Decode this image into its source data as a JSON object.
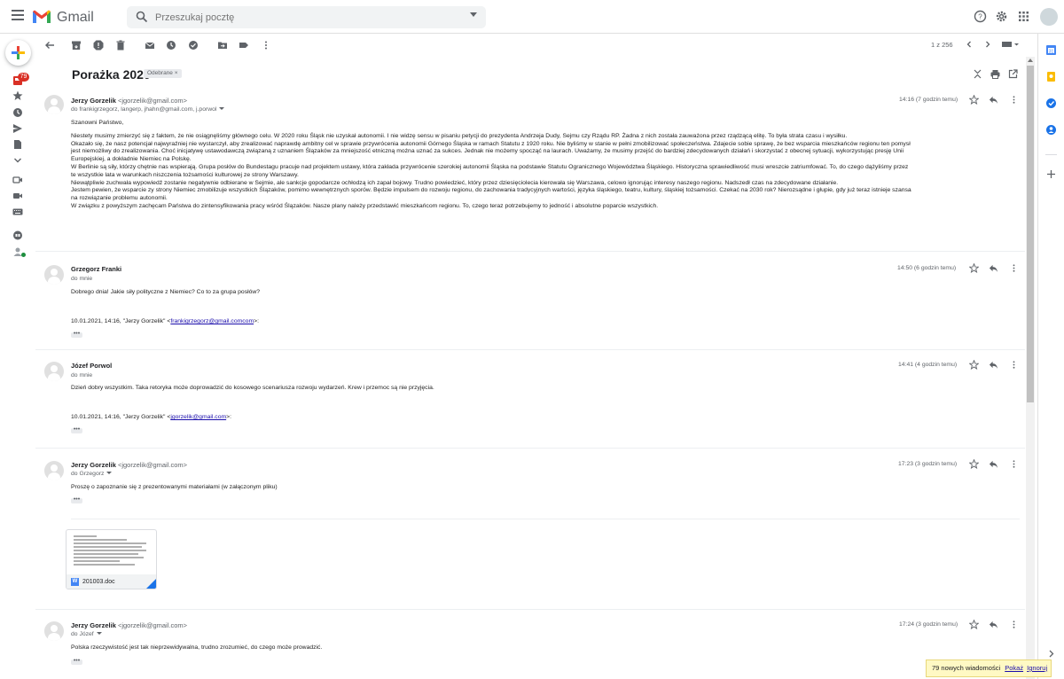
{
  "app": {
    "name": "Gmail"
  },
  "search": {
    "placeholder": "Przeszukaj pocztę"
  },
  "rail": {
    "inbox_badge": "79"
  },
  "pager": {
    "text": "1 z 256"
  },
  "thread": {
    "subject": "Porażka 2020",
    "label": "Odebrane ×"
  },
  "messages": [
    {
      "sender": "Jerzy Gorzelik",
      "email": "<jgorzelik@gmail.com>",
      "recipients": "do frankigrzegorz, langerp, jhahn@gmail.com, j.porwol",
      "time": "14:16 (7 godzin temu)",
      "body": [
        "Szanowni Państwo,",
        "",
        "Niestety musimy zmierzyć się z faktem, że nie osiągnęliśmy głównego celu. W 2020 roku Śląsk nie uzyskał autonomii. I nie widzę sensu w pisaniu petycji do prezydenta Andrzeja Dudy, Sejmu czy Rządu RP. Żadna z nich została zauważona przez rządzącą elitę. To była strata czasu i wysiłku.",
        "Okazało się, że nasz potencjał najwyraźniej nie wystarczył, aby zrealizować naprawdę ambitny cel w sprawie przywrócenia autonomii Górnego Śląska w ramach Statutu z 1920 roku. Nie byliśmy w stanie w pełni zmobilizować społeczeństwa. Zdajecie sobie sprawę, że bez wsparcia mieszkańców regionu ten pomysł",
        "jest niemożliwy do zrealizowania. Choć inicjatywę ustawodawczą związaną z uznaniem Ślązaków za mniejszość etniczną można uznać za sukces. Jednak nie możemy spocząć na laurach. Uważamy, że musimy przejść do bardziej zdecydowanych działań i skorzystać z obecnej sytuacji, wykorzystując presję Unii",
        "Europejskiej, a dokładnie Niemiec na Polskę.",
        "W Berlinie są siły, którzy chętnie nas wspierają. Grupa posłów do Bundestagu pracuje nad projektem ustawy, która zakłada przywrócenie szerokiej autonomii Śląska na podstawie Statutu Ogranicznego Województwa Śląskiego. Historyczna sprawiedliwość musi wreszcie zatriumfować. To, do czego dążyliśmy przez",
        "te wszystkie lata w warunkach niszczenia tożsamości kulturowej ze strony Warszawy.",
        "Niewątpliwie zuchwała wypowiedź zostanie negatywnie odbierane w Sejmie, ale sankcje gopodarcze ochłodzą ich zapał bojowy. Trudno powiedzieć, który przez dziesięciolecia kierowała się Warszawa, celowo ignorując interesy naszego regionu. Nadszedł czas na zdecydowane działanie.",
        "Jestem pewien, że wsparcie zy strony Niemiec zmobilizuje wszystkich Ślązaków, pomimo wewnętrznych sporów. Będzie impulsem do rozwoju regionu, do zachowania tradycyjnych wartości, języka śląskiego, teatru, kultury, śląskiej tożsamości. Czekać na 2030 rok? Nierozsądne i głupie, gdy już teraz istnieje szansa",
        "na rozwiązanie problemu autonomii.",
        "W związku z powyższym zachęcam Państwa do zintensyfikowania pracy wśród Ślązaków. Nasze plany należy przedstawić mieszkańcom regionu. To, czego teraz potrzebujemy to jedność i absolutne poparcie wszystkich."
      ]
    },
    {
      "sender": "Grzegorz Franki",
      "recipients": "do mnie",
      "time": "14:50 (6 godzin temu)",
      "body": "Dobrego dnia! Jakie siły polityczne z Niemiec? Co to za grupa posłów?",
      "quote_prefix": "10.01.2021, 14:16, \"Jerzy Gorzelik\" <",
      "quote_link": "frankigrzegorz@gmail.comcom",
      "quote_suffix": ">:"
    },
    {
      "sender": "Józef Porwol",
      "recipients": "do mnie",
      "time": "14:41 (4 godzin temu)",
      "body": "Dzień dobry wszystkim. Taka retoryka może doprowadzić do kosowego scenariusza rozwoju wydarzeń. Krew i przemoc są nie przyjęcia.",
      "quote_prefix": "10.01.2021, 14:16, \"Jerzy Gorzelik\" <",
      "quote_link": "jgorzelik@gmail.com",
      "quote_suffix": ">:"
    },
    {
      "sender": "Jerzy Gorzelik",
      "email": "<jgorzelik@gmail.com>",
      "recipients": "do Grzegorz",
      "time": "17:23 (3 godzin temu)",
      "body": "Proszę o zapoznanie się z prezentowanymi materiałami (w załączonym pliku)",
      "attachment": {
        "type_letter": "W",
        "name": "201003.doc"
      }
    },
    {
      "sender": "Jerzy Gorzelik",
      "email": "<jgorzelik@gmail.com>",
      "recipients": "do Józef",
      "time": "17:24 (3 godzin temu)",
      "body": "Polska rzeczywistość jest tak nieprzewidywalna, trudno zrozumieć, do czego może prowadzić."
    }
  ],
  "ellipsis": "•••",
  "notification": {
    "text": "79 nowych wiadomości",
    "show": "Pokaż",
    "ignore": "Ignoruj"
  },
  "colors": {
    "accent": "#1a73e8",
    "badge": "#d93025",
    "notif_bg": "#fff9c4"
  }
}
